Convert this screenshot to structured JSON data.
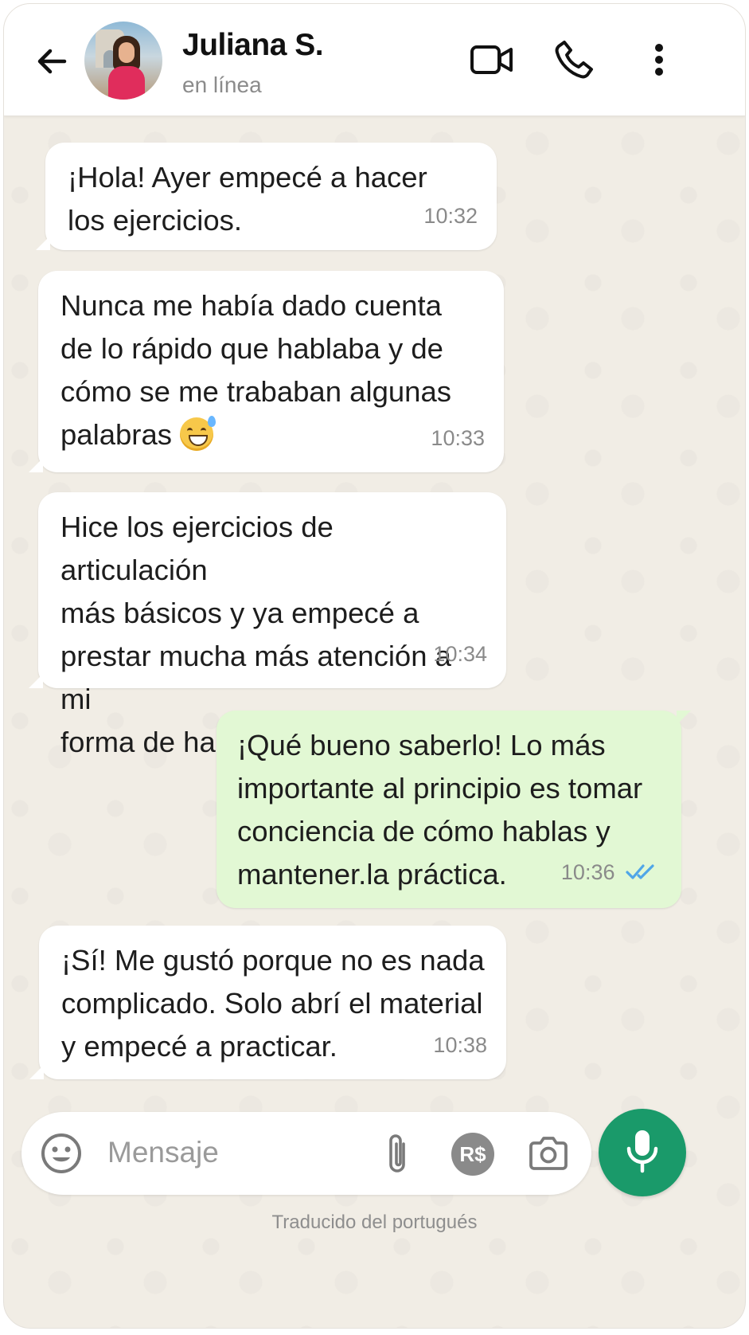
{
  "header": {
    "contact_name": "Juliana S.",
    "status": "en línea",
    "icons": [
      "back-arrow-icon",
      "video-call-icon",
      "phone-call-icon",
      "more-vertical-icon"
    ]
  },
  "messages": [
    {
      "direction": "in",
      "text": "¡Hola! Ayer empecé a hacer\nlos ejercicios.",
      "time": "10:32"
    },
    {
      "direction": "in",
      "text": "Nunca me había dado cuenta\nde lo rápido que hablaba y de\ncómo se me trababan algunas\npalabras",
      "emoji": "sweat-smile-emoji",
      "time": "10:33"
    },
    {
      "direction": "in",
      "text": "Hice los ejercicios de articulación\nmás básicos y ya empecé a\nprestar mucha más atención a mi\nforma de hablar.",
      "time": "10:34"
    },
    {
      "direction": "out",
      "text": "¡Qué bueno saberlo! Lo más\nimportante al principio es tomar\nconciencia de cómo hablas y\nmantener.la práctica.",
      "time": "10:36",
      "read_status": "double-check-read"
    },
    {
      "direction": "in",
      "text": "¡Sí! Me gustó porque no es nada\ncomplicado. Solo abrí el material\ny empecé a practicar.",
      "time": "10:38"
    }
  ],
  "input": {
    "placeholder": "Mensaje",
    "payment_label": "R$",
    "icons": [
      "emoji-icon",
      "attach-icon",
      "payment-icon",
      "camera-icon",
      "mic-icon"
    ]
  },
  "footer": {
    "translated_note": "Traducido del portugués"
  },
  "colors": {
    "chat_background": "#f1ede5",
    "incoming_bubble": "#ffffff",
    "outgoing_bubble": "#e2f8d4",
    "accent_green": "#1a9a6a",
    "read_tick_blue": "#4fa6e8"
  }
}
